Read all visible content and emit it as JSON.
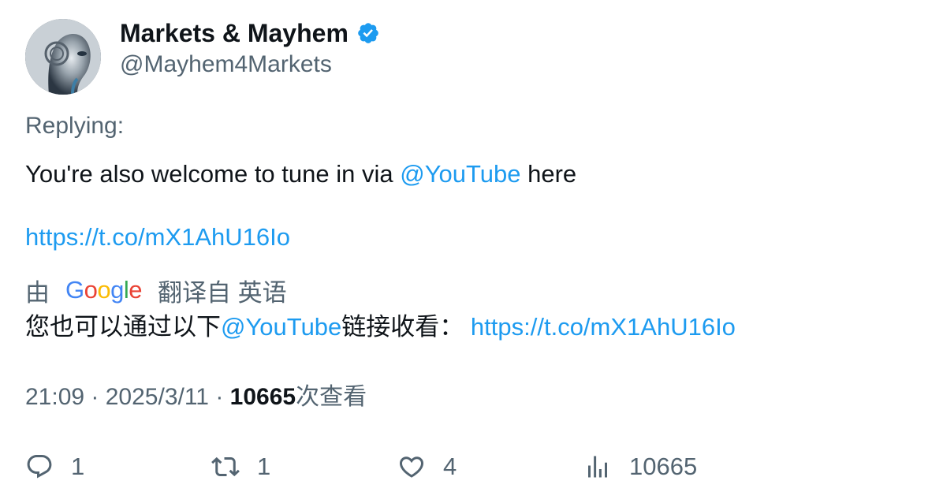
{
  "author": {
    "name": "Markets & Mayhem",
    "handle": "@Mayhem4Markets",
    "verified": true
  },
  "replying_label": "Replying:",
  "tweet": {
    "text_before": "You're also welcome to tune in via ",
    "mention": "@YouTube",
    "text_after": " here",
    "link": "https://t.co/mX1AhU16Io"
  },
  "translation": {
    "prefix": "由",
    "provider": "Google",
    "suffix": "翻译自 英语",
    "text_before": "您也可以通过以下",
    "mention": "@YouTube",
    "text_after": "链接收看： ",
    "link": "https://t.co/mX1AhU16Io"
  },
  "meta": {
    "time": "21:09",
    "separator1": " · ",
    "date": "2025/3/11",
    "separator2": " · ",
    "views": "10665",
    "views_label": "次查看"
  },
  "actions": {
    "replies": "1",
    "retweets": "1",
    "likes": "4",
    "views": "10665"
  },
  "colors": {
    "link": "#1d9bf0",
    "secondary_text": "#536471",
    "primary_text": "#0f1419",
    "verified": "#1d9bf0"
  }
}
